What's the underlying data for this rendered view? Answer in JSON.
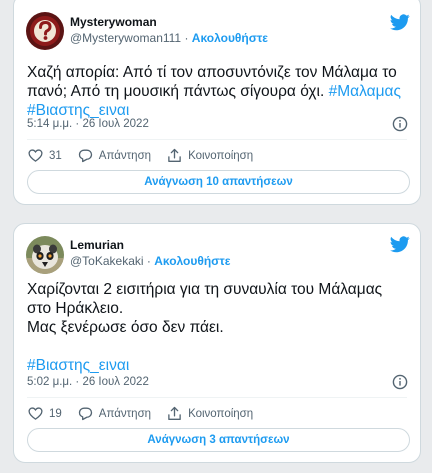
{
  "tweets": [
    {
      "display_name": "Mysterywoman",
      "handle": "@Mysterywoman111",
      "separator": "·",
      "follow_label": "Ακολουθήστε",
      "text_lines": [
        "Χαζή απορία: Από τί τον αποσυντόνιζε τον Μάλαμα το",
        "πανό; Από τη μουσική πάντως σίγουρα όχι."
      ],
      "hashtags": [
        "#Μαλαμας",
        "#Βιαστης_ειναι"
      ],
      "timestamp": "5:14 μ.μ. · 26 Ιουλ 2022",
      "like_count": "31",
      "reply_label": "Απάντηση",
      "share_label": "Κοινοποίηση",
      "read_replies_label": "Ανάγνωση 10 απαντήσεων",
      "avatar_icon": "question-mark-avatar"
    },
    {
      "display_name": "Lemurian",
      "handle": "@ToKakekaki",
      "separator": "·",
      "follow_label": "Ακολουθήστε",
      "text_lines": [
        "Χαρίζονται 2 εισιτήρια για τη συναυλία του Μάλαμας",
        "στο Ηράκλειο.",
        "Μας ξενέρωσε όσο δεν πάει."
      ],
      "hashtags": [
        "#Βιαστης_ειναι"
      ],
      "timestamp": "5:02 μ.μ. · 26 Ιουλ 2022",
      "like_count": "19",
      "reply_label": "Απάντηση",
      "share_label": "Κοινοποίηση",
      "read_replies_label": "Ανάγνωση 3 απαντήσεων",
      "avatar_icon": "lemur-avatar"
    }
  ],
  "colors": {
    "accent": "#1d9bf0",
    "text": "#0f1419",
    "secondary": "#536471",
    "border": "#cfd9de",
    "background": "#e9ebed"
  }
}
